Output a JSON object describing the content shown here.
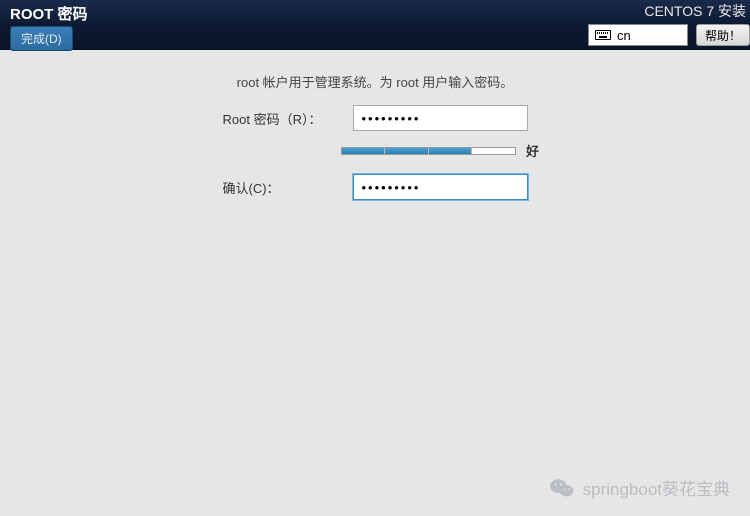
{
  "header": {
    "title": "ROOT 密码",
    "done_button": "完成(D)",
    "installer_title": "CENTOS 7 安装",
    "language_code": "cn",
    "help_button": "帮助！"
  },
  "main": {
    "instruction": "root 帐户用于管理系统。为 root 用户输入密码。",
    "password_label": "Root 密码（R）：",
    "password_value": "•••••••••",
    "strength_label": "好",
    "strength_filled": 3,
    "strength_total": 4,
    "confirm_label": "确认(C)：",
    "confirm_value": "•••••••••"
  },
  "watermark": {
    "text": "springboot葵花宝典"
  }
}
